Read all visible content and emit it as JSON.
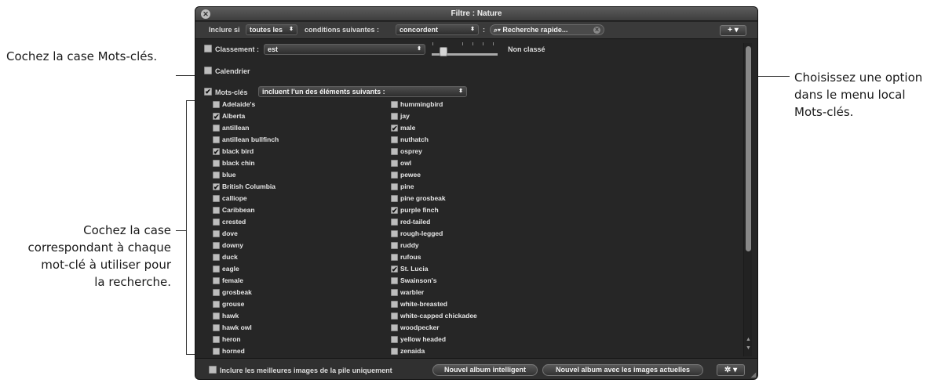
{
  "window": {
    "title": "Filtre : Nature"
  },
  "toolbar": {
    "include_label": "Inclure si",
    "match_popup": "toutes les",
    "conditions_label": "conditions suivantes :",
    "concord_popup": "concordent",
    "colon": ":",
    "search_placeholder": "Recherche rapide...",
    "add_button": "+ ▾"
  },
  "rating": {
    "label": "Classement :",
    "operator": "est",
    "value_text": "Non classé",
    "checked": false
  },
  "calendar": {
    "label": "Calendrier",
    "checked": false
  },
  "keywords": {
    "label": "Mots-clés",
    "checked": true,
    "option": "incluent l'un des éléments suivants :",
    "column1": [
      {
        "label": "Adelaide's",
        "checked": false
      },
      {
        "label": "Alberta",
        "checked": true
      },
      {
        "label": "antillean",
        "checked": false
      },
      {
        "label": "antillean bullfinch",
        "checked": false
      },
      {
        "label": "black bird",
        "checked": true
      },
      {
        "label": "black chin",
        "checked": false
      },
      {
        "label": "blue",
        "checked": false
      },
      {
        "label": "British Columbia",
        "checked": true
      },
      {
        "label": "calliope",
        "checked": false
      },
      {
        "label": "Caribbean",
        "checked": false
      },
      {
        "label": "crested",
        "checked": false
      },
      {
        "label": "dove",
        "checked": false
      },
      {
        "label": "downy",
        "checked": false
      },
      {
        "label": "duck",
        "checked": false
      },
      {
        "label": "eagle",
        "checked": false
      },
      {
        "label": "female",
        "checked": false
      },
      {
        "label": "grosbeak",
        "checked": false
      },
      {
        "label": "grouse",
        "checked": false
      },
      {
        "label": "hawk",
        "checked": false
      },
      {
        "label": "hawk owl",
        "checked": false
      },
      {
        "label": "heron",
        "checked": false
      },
      {
        "label": "horned",
        "checked": false
      }
    ],
    "column2": [
      {
        "label": "hummingbird",
        "checked": false
      },
      {
        "label": "jay",
        "checked": false
      },
      {
        "label": "male",
        "checked": true
      },
      {
        "label": "nuthatch",
        "checked": false
      },
      {
        "label": "osprey",
        "checked": false
      },
      {
        "label": "owl",
        "checked": false
      },
      {
        "label": "pewee",
        "checked": false
      },
      {
        "label": "pine",
        "checked": false
      },
      {
        "label": "pine grosbeak",
        "checked": false
      },
      {
        "label": "purple finch",
        "checked": true
      },
      {
        "label": "red-tailed",
        "checked": false
      },
      {
        "label": "rough-legged",
        "checked": false
      },
      {
        "label": "ruddy",
        "checked": false
      },
      {
        "label": "rufous",
        "checked": false
      },
      {
        "label": "St. Lucia",
        "checked": true
      },
      {
        "label": "Swainson's",
        "checked": false
      },
      {
        "label": "warbler",
        "checked": false
      },
      {
        "label": "white-breasted",
        "checked": false
      },
      {
        "label": "white-capped chickadee",
        "checked": false
      },
      {
        "label": "woodpecker",
        "checked": false
      },
      {
        "label": "yellow headed",
        "checked": false
      },
      {
        "label": "zenaida",
        "checked": false
      }
    ]
  },
  "bottom": {
    "best_images_label": "Inclure les meilleures images de la pile uniquement",
    "new_smart_album": "Nouvel album intelligent",
    "new_album_current": "Nouvel album avec les images actuelles",
    "gear_button": "✲ ▾"
  },
  "callouts": {
    "motscles": "Cochez la case Mots-clés.",
    "option_line1": "Choisissez une option",
    "option_line2": "dans le menu local",
    "option_line3": "Mots-clés.",
    "case_line1": "Cochez la case",
    "case_line2": "correspondant à chaque",
    "case_line3": "mot-clé à utiliser pour",
    "case_line4": "la recherche."
  }
}
